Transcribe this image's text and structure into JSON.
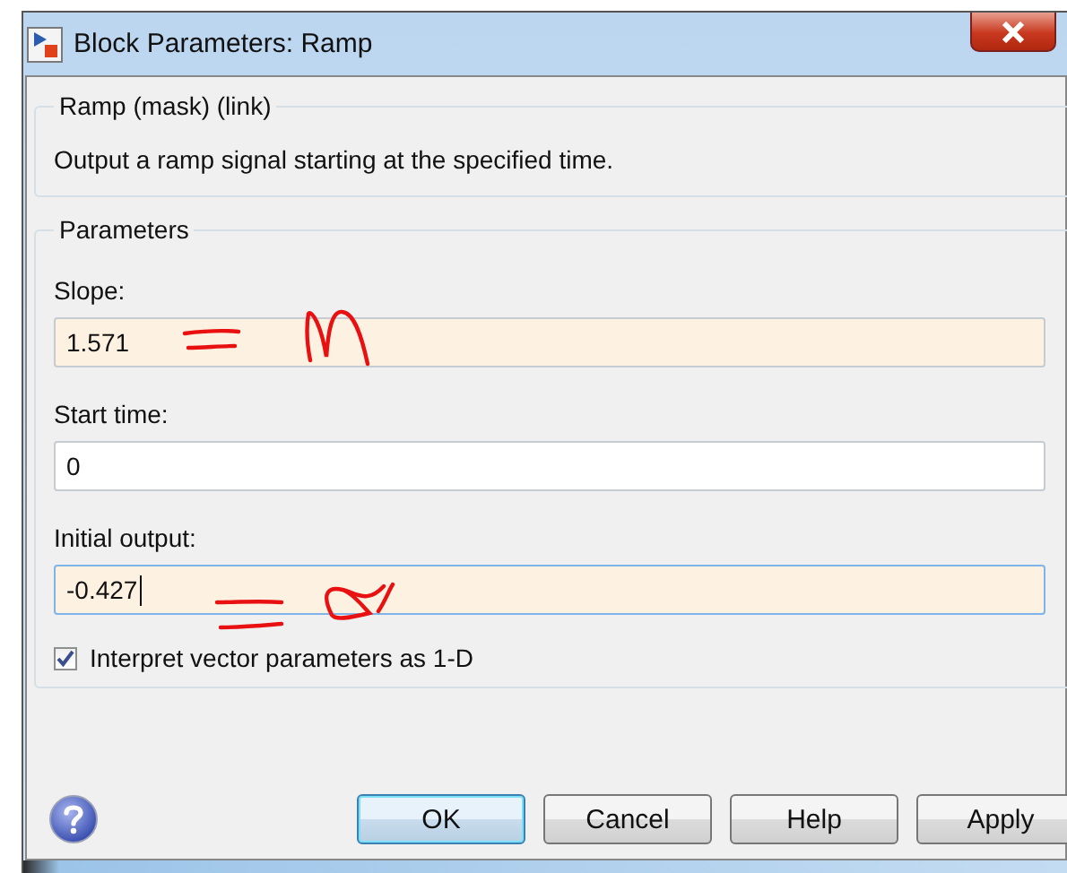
{
  "window": {
    "title": "Block Parameters: Ramp"
  },
  "description_group": {
    "title": "Ramp (mask) (link)",
    "text": "Output a ramp signal starting at the specified time."
  },
  "parameters_group": {
    "title": "Parameters",
    "fields": [
      {
        "label": "Slope:",
        "value": "1.571",
        "modified": true,
        "focused": false
      },
      {
        "label": "Start time:",
        "value": "0",
        "modified": false,
        "focused": false
      },
      {
        "label": "Initial output:",
        "value": "-0.427",
        "modified": true,
        "focused": true
      }
    ],
    "checkbox": {
      "label": "Interpret vector parameters as 1-D",
      "checked": true
    }
  },
  "buttons": [
    {
      "label": "OK",
      "default": true
    },
    {
      "label": "Cancel",
      "default": false
    },
    {
      "label": "Help",
      "default": false
    },
    {
      "label": "Apply",
      "default": false
    }
  ]
}
